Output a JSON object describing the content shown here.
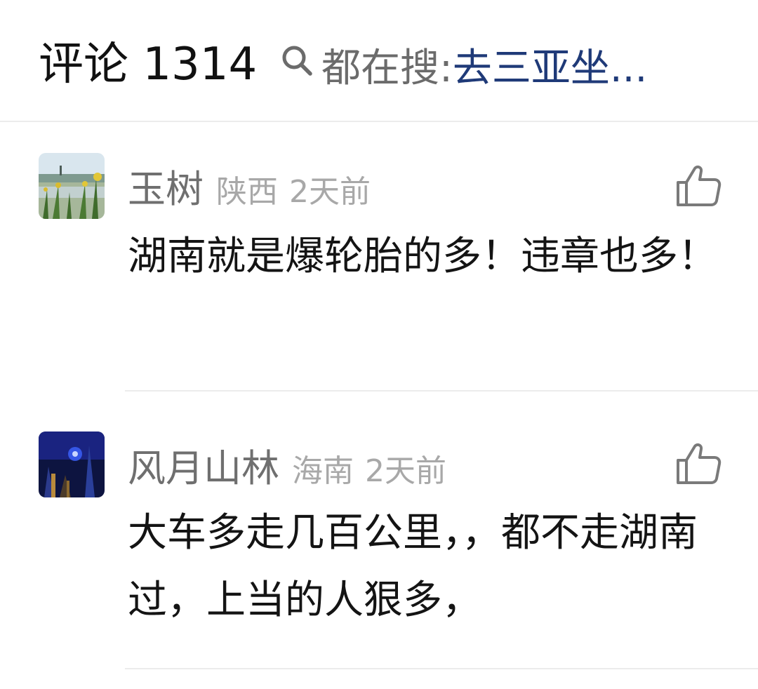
{
  "header": {
    "comment_label": "评论 1314",
    "search_prefix": "都在搜: ",
    "search_term": "去三亚坐..."
  },
  "comments": [
    {
      "username": "玉树",
      "location": "陕西",
      "time": "2天前",
      "text": "湖南就是爆轮胎的多！违章也多！",
      "avatar_icon": "landscape-flowers-avatar"
    },
    {
      "username": "风月山林",
      "location": "海南",
      "time": "2天前",
      "text": "大车多走几百公里，，都不走湖南过，上当的人狠多，",
      "avatar_icon": "night-scene-avatar"
    }
  ],
  "icons": {
    "search": "search-icon",
    "like": "thumbs-up-icon"
  },
  "colors": {
    "search_term": "#1f3a78",
    "username": "#6f6f6f",
    "meta": "#a8a8a8",
    "divider": "#ececec"
  }
}
